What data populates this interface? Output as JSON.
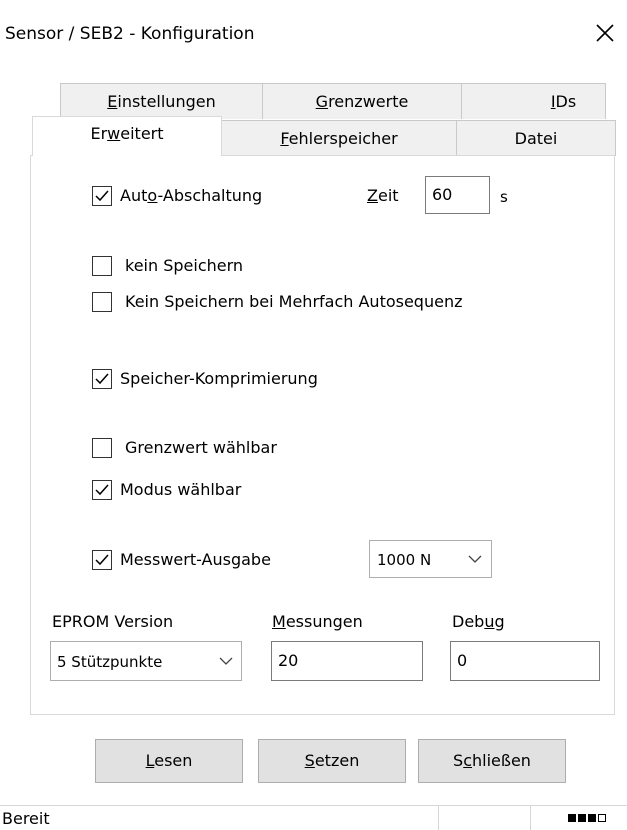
{
  "window": {
    "title": "Sensor / SEB2 - Konfiguration"
  },
  "tabs_back": [
    {
      "pre": "",
      "key": "E",
      "post": "instellungen"
    },
    {
      "pre": "",
      "key": "G",
      "post": "renzwerte"
    },
    {
      "pre": "",
      "key": "I",
      "post": "Ds"
    }
  ],
  "tabs_front": [
    {
      "pre": "Er",
      "key": "w",
      "post": "eitert"
    },
    {
      "pre": "",
      "key": "F",
      "post": "ehlerspeicher"
    },
    {
      "pre": "Datei",
      "key": "",
      "post": ""
    }
  ],
  "options": {
    "auto_off": {
      "pre": "Aut",
      "key": "o",
      "post": "-Abschaltung",
      "checked": true
    },
    "zeit": {
      "pre": "",
      "key": "Z",
      "post": "eit",
      "value": "60",
      "unit": "s"
    },
    "kein_speichern": {
      "label": "kein Speichern",
      "checked": false
    },
    "kein_speichern_auto": {
      "label": "Kein Speichern bei Mehrfach Autosequenz",
      "checked": false
    },
    "kompression": {
      "label": "Speicher-Komprimierung",
      "checked": true
    },
    "grenzwert": {
      "label": "Grenzwert wählbar",
      "checked": false
    },
    "modus": {
      "label": "Modus wählbar",
      "checked": true
    },
    "messwert": {
      "label": "Messwert-Ausgabe",
      "checked": true,
      "select_value": "1000 N"
    }
  },
  "eprom": {
    "label": "EPROM Version",
    "select_value": "5 Stützpunkte"
  },
  "messungen": {
    "pre": "",
    "key": "M",
    "post": "essungen",
    "value": "20"
  },
  "debug": {
    "pre": "Deb",
    "key": "u",
    "post": "g",
    "value": "0"
  },
  "buttons": {
    "lesen": {
      "pre": "",
      "key": "L",
      "post": "esen"
    },
    "setzen": {
      "pre": "",
      "key": "S",
      "post": "etzen"
    },
    "schliessen": {
      "pre": "S",
      "key": "c",
      "post": "hließen"
    }
  },
  "status": {
    "text": "Bereit"
  }
}
